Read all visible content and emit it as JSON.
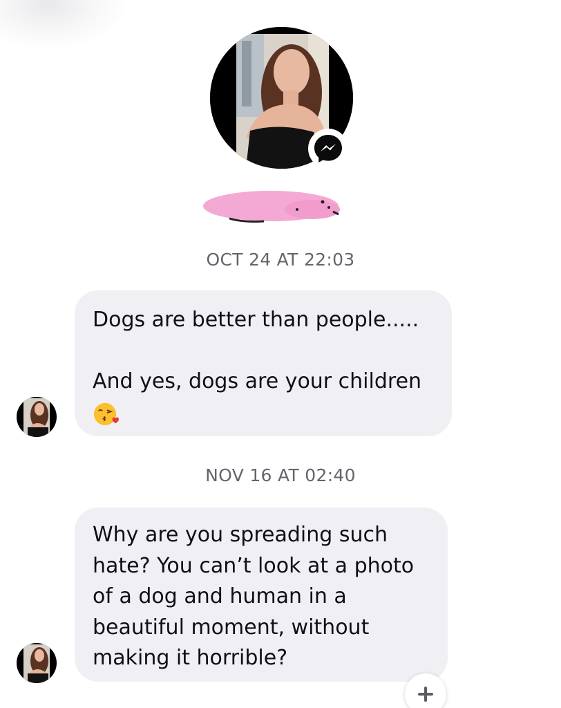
{
  "profile": {
    "avatar_icon": "profile-photo",
    "badge_icon": "messenger-icon",
    "name_redacted": true
  },
  "thread": [
    {
      "timestamp": "OCT 24 AT 22:03",
      "message_line_1": "Dogs are better than people.....",
      "message_line_2": "And yes, dogs are your children",
      "emoji": "kissing-face-with-heart-emoji"
    },
    {
      "timestamp": "NOV 16 AT 02:40",
      "message": "Why are you spreading such\nhate? You can’t look at a photo\nof a dog and human in a\nbeautiful moment, without\nmaking it horrible?"
    }
  ],
  "actions": {
    "add_reaction_icon": "plus-icon"
  },
  "colors": {
    "bubble_bg": "#f0f0f4",
    "timestamp_text": "#62656b",
    "message_text": "#0f1016",
    "redaction_pink": "#f4a9d4"
  }
}
